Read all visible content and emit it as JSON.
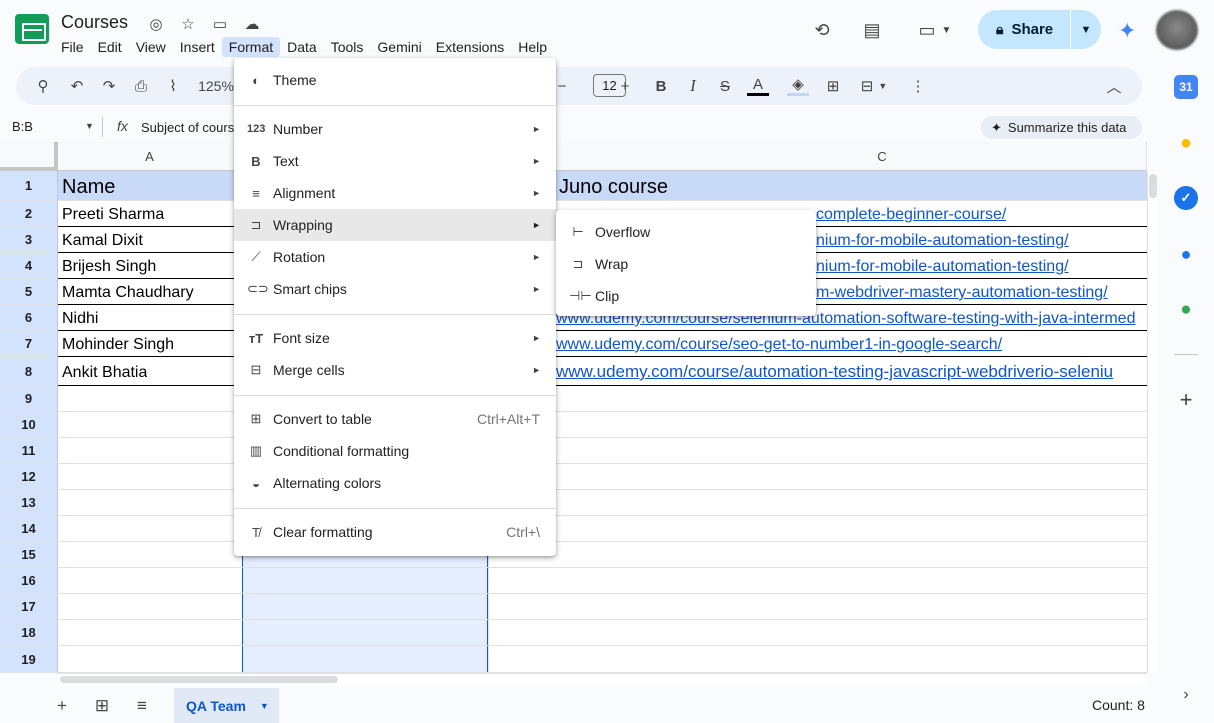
{
  "app": {
    "title": "Courses",
    "menu": [
      "File",
      "Edit",
      "View",
      "Insert",
      "Format",
      "Data",
      "Tools",
      "Gemini",
      "Extensions",
      "Help"
    ],
    "share_label": "Share"
  },
  "toolbar": {
    "zoom": "125%",
    "font_size": "12"
  },
  "formula_bar": {
    "name_box": "B:B",
    "fx": "fx",
    "value": "Subject of course",
    "summarize": "Summarize this data"
  },
  "grid": {
    "columns": [
      "A",
      "C"
    ],
    "rows": [
      "1",
      "2",
      "3",
      "4",
      "5",
      "6",
      "7",
      "8",
      "9",
      "10",
      "11",
      "12",
      "13",
      "14",
      "15",
      "16",
      "17",
      "18",
      "19"
    ],
    "header_a": "Name",
    "header_c": "Juno course",
    "names": [
      "Preeti Sharma",
      "Kamal Dixit",
      "Brijesh Singh",
      "Mamta Chaudhary",
      "Nidhi",
      "Mohinder Singh",
      "Ankit Bhatia"
    ],
    "links": [
      "complete-beginner-course/",
      "nium-for-mobile-automation-testing/",
      "nium-for-mobile-automation-testing/",
      "m-webdriver-mastery-automation-testing/",
      "www.udemy.com/course/selenium-automation-software-testing-with-java-intermed",
      "www.udemy.com/course/seo-get-to-number1-in-google-search/",
      "www.udemy.com/course/automation-testing-javascript-webdriverio-seleniu"
    ]
  },
  "format_menu": {
    "items": [
      {
        "label": "Theme",
        "icon": "palette-icon"
      },
      {
        "label": "Number",
        "icon": "number-icon"
      },
      {
        "label": "Text",
        "icon": "bold-icon"
      },
      {
        "label": "Alignment",
        "icon": "align-icon"
      },
      {
        "label": "Wrapping",
        "icon": "wrap-icon"
      },
      {
        "label": "Rotation",
        "icon": "rotation-icon"
      },
      {
        "label": "Smart chips",
        "icon": "chip-icon"
      },
      {
        "label": "Font size",
        "icon": "font-size-icon"
      },
      {
        "label": "Merge cells",
        "icon": "merge-icon"
      },
      {
        "label": "Convert to table",
        "icon": "table-icon",
        "shortcut": "Ctrl+Alt+T"
      },
      {
        "label": "Conditional formatting",
        "icon": "paint-roller-icon"
      },
      {
        "label": "Alternating colors",
        "icon": "drop-icon"
      },
      {
        "label": "Clear formatting",
        "icon": "clear-format-icon",
        "shortcut": "Ctrl+\\"
      }
    ]
  },
  "wrapping_submenu": {
    "items": [
      "Overflow",
      "Wrap",
      "Clip"
    ]
  },
  "sheet_tabs": {
    "active": "QA Team",
    "count": "Count: 8"
  }
}
